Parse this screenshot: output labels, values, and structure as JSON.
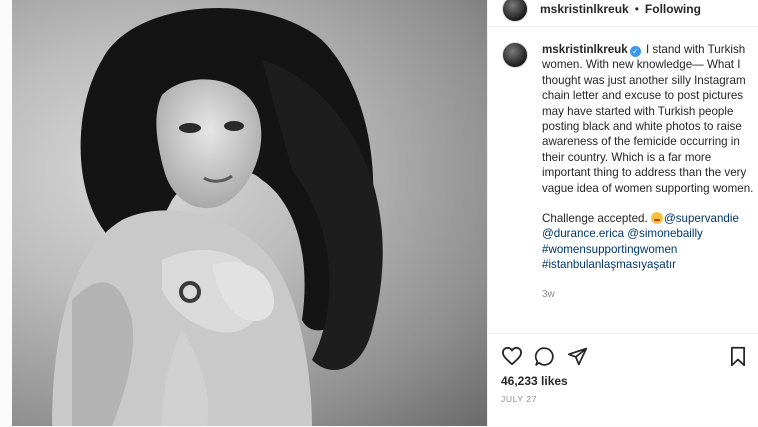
{
  "post": {
    "username": "mskristinlkreuk",
    "header_separator": "•",
    "header_follow": "Following",
    "caption_part1": "I stand with Turkish women. With new knowledge— What I thought was just another silly Instagram chain letter and excuse to post pictures may have started with Turkish people posting black and white photos to raise awareness of the femicide occurring in their country. Which is a far more important thing to address than the very vague idea of women supporting women.",
    "caption_part2_lead": "Challenge accepted.",
    "mention1": "@supervandie",
    "mention2": "@durance.erica",
    "mention3": "@simonebailly",
    "hashtag1": "#womensupportingwomen",
    "hashtag2": "#istanbulanlaşmasıyaşatır",
    "time_ago": "3w",
    "likes": "46,233 likes",
    "date": "JULY 27"
  },
  "icons": {
    "like": "heart-outline-icon",
    "comment": "comment-bubble-icon",
    "share": "paper-plane-icon",
    "save": "bookmark-icon",
    "verified": "verified-badge-icon",
    "emoji": "winking-kiss-emoji"
  },
  "colors": {
    "link": "#00376b",
    "verified": "#3897f0",
    "muted": "#8e8e8e",
    "text": "#262626"
  }
}
